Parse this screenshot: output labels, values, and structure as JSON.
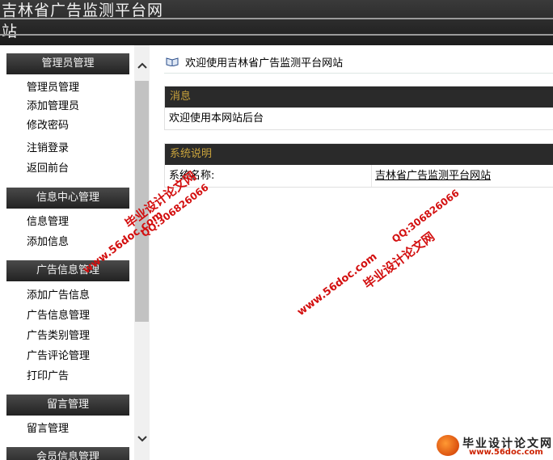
{
  "header": {
    "title": "吉林省广告监测平台网站"
  },
  "sidebar": {
    "sections": [
      {
        "title": "管理员管理",
        "items": [
          "管理员管理",
          "添加管理员",
          "修改密码",
          "注销登录",
          "返回前台"
        ]
      },
      {
        "title": "信息中心管理",
        "items": [
          "信息管理",
          "添加信息"
        ]
      },
      {
        "title": "广告信息管理",
        "items": [
          "添加广告信息",
          "广告信息管理",
          "广告类别管理",
          "广告评论管理",
          "打印广告"
        ]
      },
      {
        "title": "留言管理",
        "items": [
          "留言管理"
        ]
      },
      {
        "title": "会员信息管理",
        "items": []
      }
    ]
  },
  "scrollbar": {
    "up": "⌃",
    "down": "⌄"
  },
  "main": {
    "welcome": "欢迎使用吉林省广告监测平台网站",
    "messages": {
      "title": "消息",
      "body": "欢迎使用本网站后台"
    },
    "system": {
      "title": "系统说明",
      "rows": [
        {
          "label": "系统名称:",
          "value": "吉林省广告监测平台网站"
        }
      ]
    }
  },
  "watermarks": {
    "brand": "毕业设计论文网",
    "qq": "QQ:306826066",
    "url": "www.56doc.com"
  },
  "footer": {
    "brand": "毕业设计论文网",
    "site": "www.56doc.com"
  }
}
